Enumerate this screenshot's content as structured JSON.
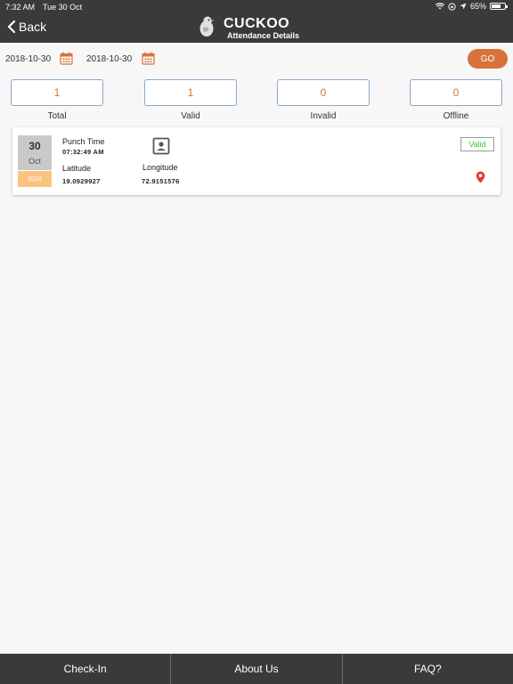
{
  "status_bar": {
    "time": "7:32 AM",
    "date": "Tue 30 Oct",
    "battery": "65%"
  },
  "nav": {
    "back_label": "Back",
    "app_name": "CUCKOO",
    "subtitle": "Attendance Details"
  },
  "filter": {
    "from_date": "2018-10-30",
    "to_date": "2018-10-30",
    "go_label": "GO"
  },
  "stats": [
    {
      "value": "1",
      "label": "Total"
    },
    {
      "value": "1",
      "label": "Valid"
    },
    {
      "value": "0",
      "label": "Invalid"
    },
    {
      "value": "0",
      "label": "Offline"
    }
  ],
  "record": {
    "day": "30",
    "month": "Oct",
    "year": "2018",
    "punch_time_label": "Punch Time",
    "punch_time": "07:32:49 AM",
    "latitude_label": "Latitude",
    "latitude": "19.0929927",
    "longitude_label": "Longitude",
    "longitude": "72.9151576",
    "status": "Valid"
  },
  "tabs": [
    "Check-In",
    "About Us",
    "FAQ?"
  ],
  "colors": {
    "accent": "#d8723a",
    "bar": "#3a3a3a",
    "valid": "#3bc43b",
    "pin": "#e53935",
    "year_bg": "#fac480"
  }
}
